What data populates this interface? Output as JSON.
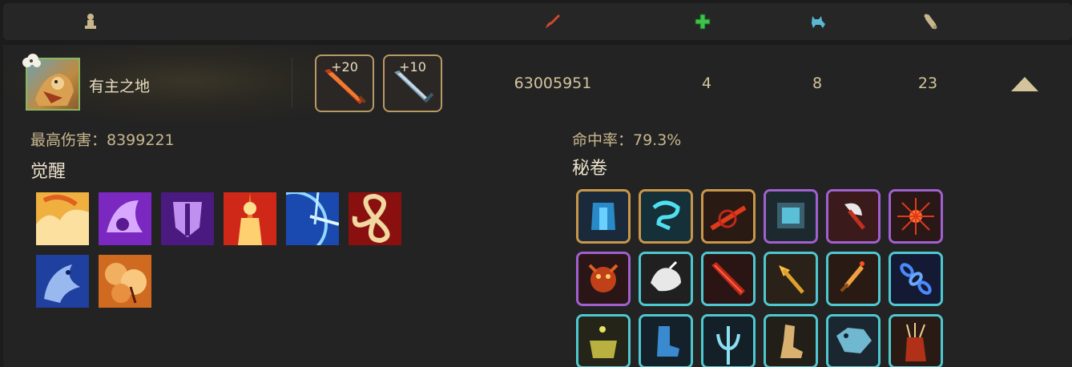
{
  "header": {
    "icons": [
      "pawn-icon",
      "sword-icon",
      "plus-icon",
      "cat-icon",
      "scroll-icon"
    ]
  },
  "player": {
    "name": "有主之地",
    "weapons": [
      {
        "level": "+20",
        "icon": "flame-sword-icon"
      },
      {
        "level": "+10",
        "icon": "steel-sword-icon"
      }
    ],
    "damage": "63005951",
    "heal": "4",
    "pet": "8",
    "scroll": "23"
  },
  "details": {
    "max_damage_label": "最高伤害：8399221",
    "hit_rate_label": "命中率：79.3%",
    "awaken_title": "觉醒",
    "scrolls_title": "秘卷",
    "awaken_skills": [
      "fire-cloud-icon",
      "purple-spirit-icon",
      "purple-mask-icon",
      "golden-warrior-icon",
      "blue-burst-icon",
      "red-swirl-icon",
      "blue-dragon-icon",
      "orange-explosion-icon"
    ],
    "rune_rows": [
      [
        {
          "icon": "blue-armor-icon",
          "rarity": "gold"
        },
        {
          "icon": "cyan-rune-icon",
          "rarity": "gold"
        },
        {
          "icon": "red-slash-icon",
          "rarity": "gold"
        },
        {
          "icon": "shield-rune-icon",
          "rarity": "purple"
        },
        {
          "icon": "axe-icon",
          "rarity": "purple"
        },
        {
          "icon": "fire-burst-icon",
          "rarity": "purple"
        }
      ],
      [
        {
          "icon": "demon-face-icon",
          "rarity": "purple"
        },
        {
          "icon": "white-bird-icon",
          "rarity": "cyan"
        },
        {
          "icon": "red-blade-icon",
          "rarity": "cyan"
        },
        {
          "icon": "golden-arrow-icon",
          "rarity": "cyan"
        },
        {
          "icon": "flaming-dagger-icon",
          "rarity": "cyan"
        },
        {
          "icon": "blue-chain-icon",
          "rarity": "cyan"
        }
      ],
      [
        {
          "icon": "golden-pot-icon",
          "rarity": "cyan"
        },
        {
          "icon": "blue-boot-icon",
          "rarity": "cyan"
        },
        {
          "icon": "trident-icon",
          "rarity": "cyan"
        },
        {
          "icon": "gold-boot-icon",
          "rarity": "cyan"
        },
        {
          "icon": "ice-wolf-icon",
          "rarity": "cyan"
        },
        {
          "icon": "arrow-quiver-icon",
          "rarity": "cyan"
        }
      ]
    ]
  }
}
